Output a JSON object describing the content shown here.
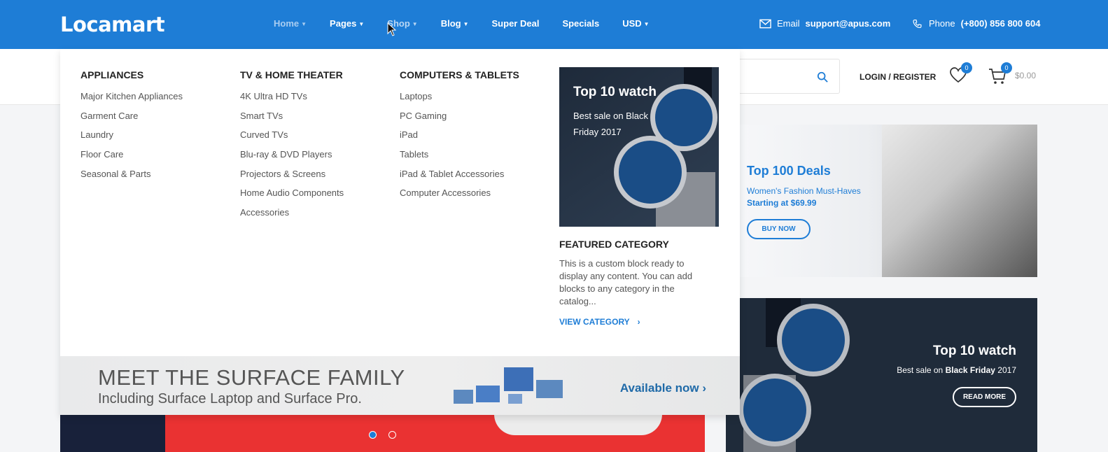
{
  "brand": {
    "logo": "Locamart"
  },
  "nav": [
    {
      "label": "Home",
      "has_dropdown": true
    },
    {
      "label": "Pages",
      "has_dropdown": true
    },
    {
      "label": "Shop",
      "has_dropdown": true
    },
    {
      "label": "Blog",
      "has_dropdown": true
    },
    {
      "label": "Super Deal",
      "has_dropdown": false
    },
    {
      "label": "Specials",
      "has_dropdown": false
    },
    {
      "label": "USD",
      "has_dropdown": true
    }
  ],
  "contact": {
    "email_label": "Email",
    "email": "support@apus.com",
    "phone_label": "Phone",
    "phone": "(+800) 856 800 604"
  },
  "header": {
    "login_register": "LOGIN / REGISTER",
    "wishlist_count": "0",
    "cart_count": "0",
    "cart_total": "$0.00"
  },
  "menu": {
    "columns": [
      {
        "title": "APPLIANCES",
        "items": [
          "Major Kitchen Appliances",
          "Garment Care",
          "Laundry",
          "Floor Care",
          "Seasonal & Parts"
        ]
      },
      {
        "title": "TV & HOME THEATER",
        "items": [
          "4K Ultra HD TVs",
          "Smart TVs",
          "Curved TVs",
          "Blu-ray & DVD Players",
          "Projectors & Screens",
          "Home Audio Components",
          "Accessories"
        ]
      },
      {
        "title": "COMPUTERS & TABLETS",
        "items": [
          "Laptops",
          "PC Gaming",
          "iPad",
          "Tablets",
          "iPad & Tablet Accessories",
          "Computer Accessories"
        ]
      }
    ],
    "feature": {
      "image_title": "Top 10 watch",
      "image_subtitle": "Best sale on Black Friday 2017",
      "heading": "FEATURED CATEGORY",
      "body": "This is a custom block ready to display any content. You can add blocks to any category in the catalog...",
      "link": "VIEW CATEGORY"
    },
    "surface": {
      "headline": "MEET THE SURFACE FAMILY",
      "subline": "Including Surface Laptop and Surface Pro.",
      "cta": "Available now ›"
    }
  },
  "side_promos": {
    "women": {
      "title": "Top 100 Deals",
      "subtitle": "Women's Fashion Must-Haves",
      "price": "Starting at $69.99",
      "button": "BUY NOW"
    },
    "watch": {
      "title": "Top 10 watch",
      "subtitle_prefix": "Best sale on",
      "subtitle_bold": "Black Friday",
      "subtitle_suffix": "2017",
      "button": "READ MORE"
    }
  },
  "slider": {
    "active_dot": 1,
    "dots": 2
  },
  "colors": {
    "primary": "#1e7dd6",
    "dark": "#1f2b3a",
    "slider_red": "#ea3232"
  }
}
